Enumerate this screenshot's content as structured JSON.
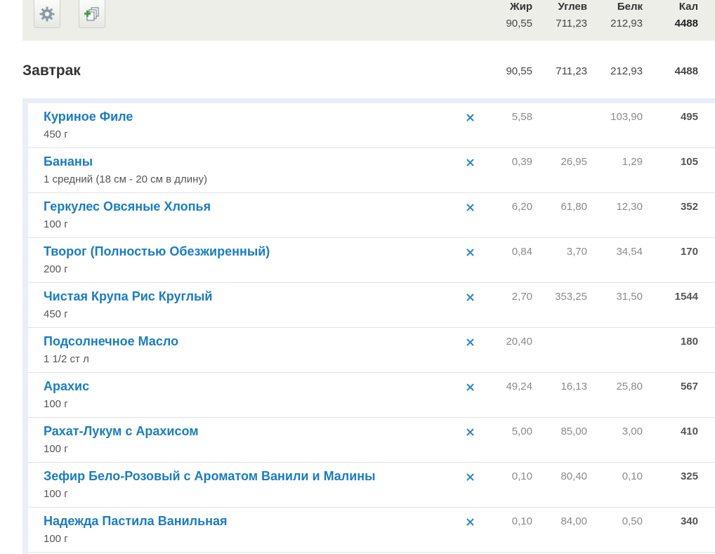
{
  "columns": {
    "fat": "Жир",
    "carbs": "Углев",
    "protein": "Белк",
    "kcal": "Кал"
  },
  "totals": {
    "fat": "90,55",
    "carbs": "711,23",
    "protein": "212,93",
    "kcal": "4488"
  },
  "meal": {
    "title": "Завтрак",
    "fat": "90,55",
    "carbs": "711,23",
    "protein": "212,93",
    "kcal": "4488"
  },
  "items": [
    {
      "name": "Куриное Филе",
      "portion": "450 г",
      "fat": "5,58",
      "carbs": "",
      "protein": "103,90",
      "kcal": "495"
    },
    {
      "name": "Бананы",
      "portion": "1 средний (18 см - 20 см в длину)",
      "fat": "0,39",
      "carbs": "26,95",
      "protein": "1,29",
      "kcal": "105"
    },
    {
      "name": "Геркулес Овсяные Хлопья",
      "portion": "100 г",
      "fat": "6,20",
      "carbs": "61,80",
      "protein": "12,30",
      "kcal": "352"
    },
    {
      "name": "Творог (Полностью Обезжиренный)",
      "portion": "200 г",
      "fat": "0,84",
      "carbs": "3,70",
      "protein": "34,54",
      "kcal": "170"
    },
    {
      "name": "Чистая Крупа Рис Круглый",
      "portion": "450 г",
      "fat": "2,70",
      "carbs": "353,25",
      "protein": "31,50",
      "kcal": "1544"
    },
    {
      "name": "Подсолнечное Масло",
      "portion": "1 1/2 ст л",
      "fat": "20,40",
      "carbs": "",
      "protein": "",
      "kcal": "180"
    },
    {
      "name": "Арахис",
      "portion": "100 г",
      "fat": "49,24",
      "carbs": "16,13",
      "protein": "25,80",
      "kcal": "567"
    },
    {
      "name": "Рахат-Лукум с Арахисом",
      "portion": "100 г",
      "fat": "5,00",
      "carbs": "85,00",
      "protein": "3,00",
      "kcal": "410"
    },
    {
      "name": "Зефир Бело-Розовый с Ароматом Ванили и Малины",
      "portion": "100 г",
      "fat": "0,10",
      "carbs": "80,40",
      "protein": "0,10",
      "kcal": "325"
    },
    {
      "name": "Надежда Пастила Ванильная",
      "portion": "100 г",
      "fat": "0,10",
      "carbs": "84,00",
      "protein": "0,50",
      "kcal": "340"
    }
  ],
  "icons": {
    "settings": "gear-icon",
    "add": "add-copy-icon",
    "delete": "close-icon"
  },
  "colors": {
    "link": "#1a7dbf",
    "toolbar_bg": "#edeee8",
    "list_border": "#e8eff7"
  }
}
